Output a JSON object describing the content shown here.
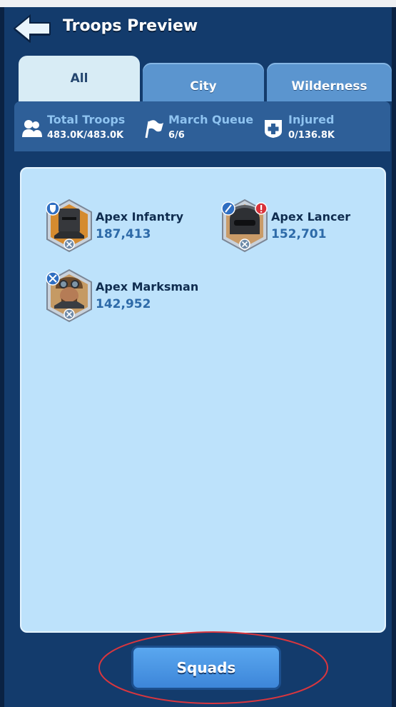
{
  "header": {
    "title": "Troops Preview",
    "back_icon": "back-arrow-icon"
  },
  "tabs": [
    {
      "label": "All",
      "selected": true
    },
    {
      "label": "City",
      "selected": false
    },
    {
      "label": "Wilderness",
      "selected": false
    }
  ],
  "stats": [
    {
      "label": "Total Troops",
      "value": "483.0K/483.0K",
      "icon": "troops-icon"
    },
    {
      "label": "March Queue",
      "value": "6/6",
      "icon": "flag-icon"
    },
    {
      "label": "Injured",
      "value": "0/136.8K",
      "icon": "medical-cross-icon"
    }
  ],
  "troops": [
    {
      "name": "Apex Infantry",
      "count": "187,413",
      "icon": "infantry-portrait",
      "badge_icon": "shield-badge-icon"
    },
    {
      "name": "Apex Lancer",
      "count": "152,701",
      "icon": "lancer-portrait",
      "badge_icon": "lance-badge-icon"
    },
    {
      "name": "Apex Marksman",
      "count": "142,952",
      "icon": "marksman-portrait",
      "badge_icon": "crossbow-badge-icon"
    }
  ],
  "footer": {
    "squads_label": "Squads"
  },
  "colors": {
    "background": "#133b6c",
    "panel": "#bde2fb",
    "tab_selected": "#d8ecf5",
    "tab_unselected": "#5b95cf",
    "button": "#4895e4",
    "highlight_ellipse": "#d9363e"
  }
}
